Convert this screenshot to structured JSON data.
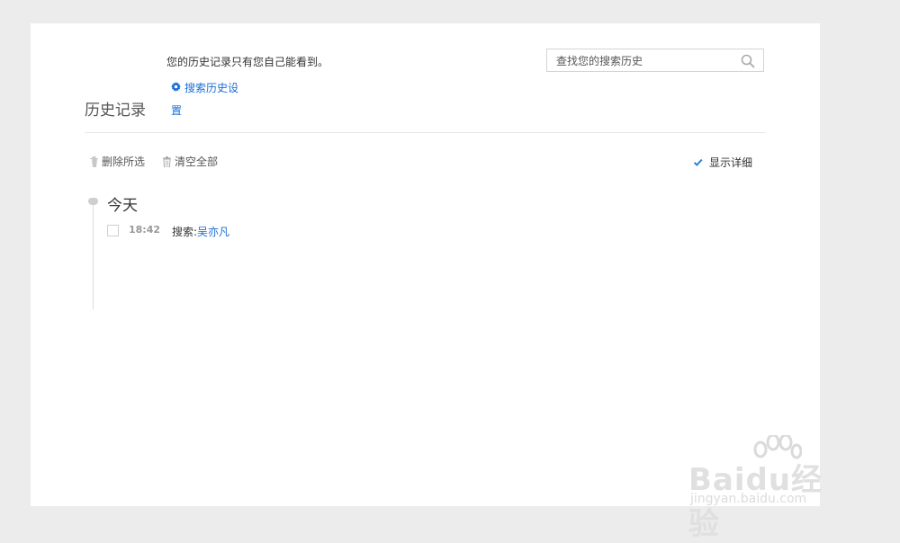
{
  "header": {
    "privacy_note": "您的历史记录只有您自己能看到。",
    "settings_link": "搜索历史设置",
    "page_title": "历史记录"
  },
  "search": {
    "placeholder": "查找您的搜索历史"
  },
  "toolbar": {
    "delete_selected": "删除所选",
    "clear_all": "清空全部",
    "show_details": "显示详细",
    "show_details_checked": true
  },
  "history": {
    "groups": [
      {
        "day": "今天",
        "entries": [
          {
            "time": "18:42",
            "prefix": "搜索:",
            "query": "吴亦凡",
            "checked": false
          }
        ]
      }
    ]
  },
  "watermark": {
    "logo_text": "Baidu经验",
    "url": "jingyan.baidu.com"
  },
  "colors": {
    "link": "#1a6dd6",
    "checkbox_accent": "#2e7fd8"
  }
}
